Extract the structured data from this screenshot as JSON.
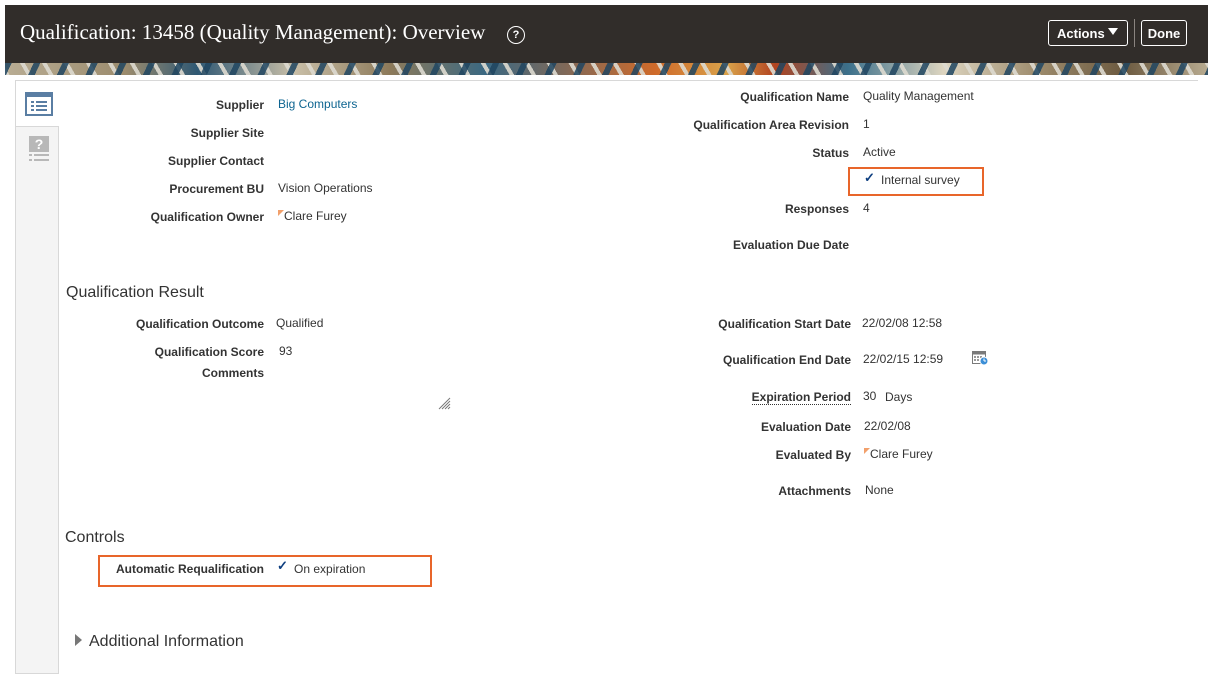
{
  "header": {
    "title": "Qualification: 13458 (Quality Management): Overview",
    "help_glyph": "?",
    "actions_label": "Actions",
    "done_label": "Done"
  },
  "general": {
    "supplier_label": "Supplier",
    "supplier_value": "Big Computers",
    "supplier_site_label": "Supplier Site",
    "supplier_contact_label": "Supplier Contact",
    "procurement_bu_label": "Procurement BU",
    "procurement_bu_value": "Vision Operations",
    "owner_label": "Qualification Owner",
    "owner_value": "Clare Furey",
    "qualification_name_label": "Qualification Name",
    "qualification_name_value": "Quality Management",
    "area_revision_label": "Qualification Area Revision",
    "area_revision_value": "1",
    "status_label": "Status",
    "status_value": "Active",
    "internal_survey_label": "Internal survey",
    "responses_label": "Responses",
    "responses_value": "4",
    "evaluation_due_label": "Evaluation Due Date"
  },
  "result": {
    "heading": "Qualification Result",
    "outcome_label": "Qualification Outcome",
    "outcome_value": "Qualified",
    "score_label": "Qualification Score",
    "score_value": "93",
    "comments_label": "Comments",
    "start_date_label": "Qualification Start Date",
    "start_date_value": "22/02/08 12:58",
    "end_date_label": "Qualification End Date",
    "end_date_value": "22/02/15 12:59",
    "expiration_period_label": "Expiration Period",
    "expiration_period_value": "30",
    "expiration_period_unit": "Days",
    "evaluation_date_label": "Evaluation Date",
    "evaluation_date_value": "22/02/08",
    "evaluated_by_label": "Evaluated By",
    "evaluated_by_value": "Clare Furey",
    "attachments_label": "Attachments",
    "attachments_value": "None"
  },
  "controls": {
    "heading": "Controls",
    "auto_requal_label": "Automatic Requalification",
    "auto_requal_value": "On expiration"
  },
  "additional": {
    "heading": "Additional Information"
  },
  "icons": {
    "checkmark": "✓",
    "highlight_color": "#e8652a",
    "link_color": "#0e6591",
    "header_bg": "#312d2a"
  }
}
